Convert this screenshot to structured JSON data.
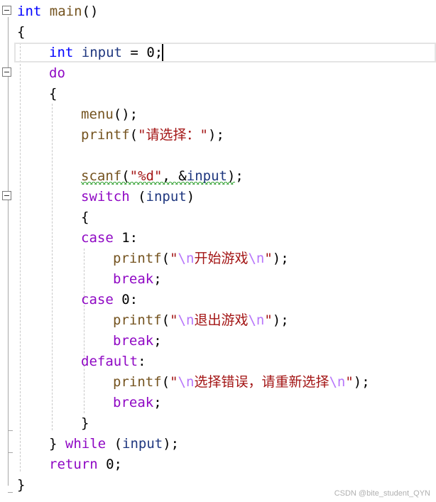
{
  "editor": {
    "tokens": {
      "int": "int",
      "main": "main",
      "parens_open": "(",
      "parens_close": ")",
      "brace_open": "{",
      "brace_close": "}",
      "input": "input",
      "assign": " = ",
      "zero": "0",
      "semicolon": ";",
      "do": "do",
      "menu": "menu",
      "printf": "printf",
      "scanf": "scanf",
      "switch": "switch",
      "case": "case",
      "one": "1",
      "colon": ":",
      "break": "break",
      "default": "default",
      "while": "while",
      "return": "return",
      "comma_amp": ", &"
    },
    "strings": {
      "prompt": "\"请选择：\"",
      "fmt": "\"%d\"",
      "quote": "\"",
      "esc_n": "\\n",
      "start_game": "开始游戏",
      "exit_game": "退出游戏",
      "error_text": "选择错误，请重新选择"
    }
  },
  "watermark": "CSDN @bite_student_QYN"
}
